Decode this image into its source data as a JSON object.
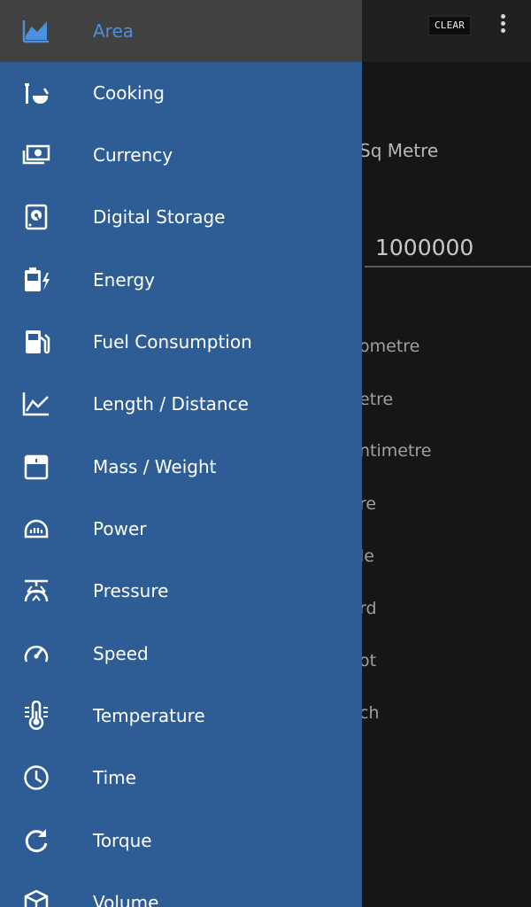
{
  "app_bar": {
    "clear_label": "CLEAR"
  },
  "converter": {
    "from_unit": "Sq Metre",
    "input_value": "1000000",
    "results": [
      "ometre",
      "etre",
      "ntimetre",
      "re",
      "le",
      "rd",
      "ot",
      "ch"
    ]
  },
  "drawer": {
    "items": [
      {
        "label": "Area",
        "icon": "area-chart-icon",
        "selected": true
      },
      {
        "label": "Cooking",
        "icon": "cooking-icon"
      },
      {
        "label": "Currency",
        "icon": "currency-icon"
      },
      {
        "label": "Digital Storage",
        "icon": "storage-disk-icon"
      },
      {
        "label": "Energy",
        "icon": "battery-charge-icon"
      },
      {
        "label": "Fuel Consumption",
        "icon": "fuel-pump-icon"
      },
      {
        "label": "Length / Distance",
        "icon": "line-chart-icon"
      },
      {
        "label": "Mass / Weight",
        "icon": "weight-scale-icon"
      },
      {
        "label": "Power",
        "icon": "power-gauge-icon"
      },
      {
        "label": "Pressure",
        "icon": "pressure-icon"
      },
      {
        "label": "Speed",
        "icon": "speedometer-icon"
      },
      {
        "label": "Temperature",
        "icon": "thermometer-icon"
      },
      {
        "label": "Time",
        "icon": "clock-icon"
      },
      {
        "label": "Torque",
        "icon": "rotate-icon"
      },
      {
        "label": "Volume",
        "icon": "cube-icon"
      }
    ]
  },
  "colors": {
    "drawer_bg": "#2e5d96",
    "selected_bg": "#414141",
    "accent": "#4b8fde",
    "background": "#161616"
  }
}
